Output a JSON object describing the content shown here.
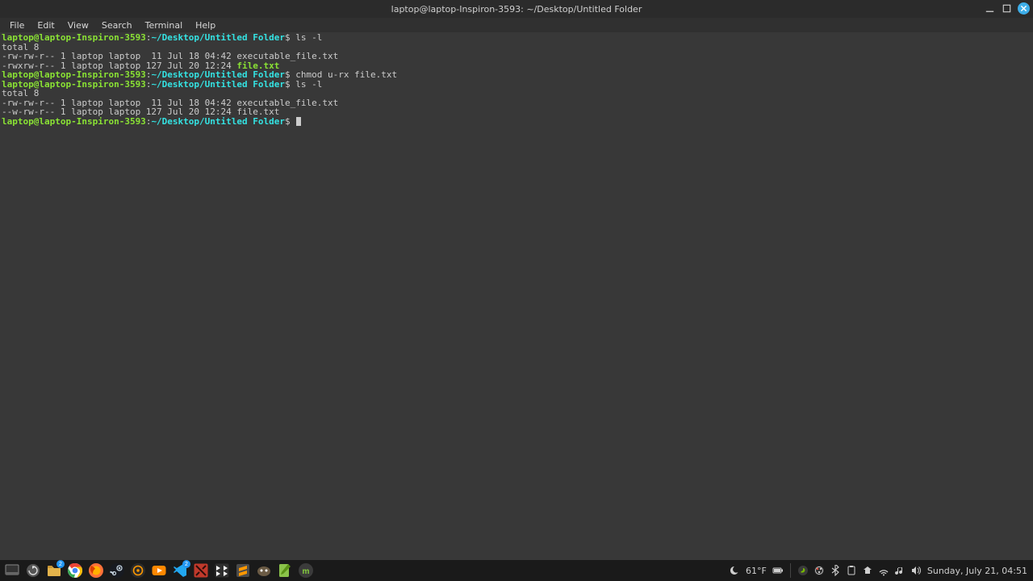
{
  "window": {
    "title": "laptop@laptop-Inspiron-3593: ~/Desktop/Untitled Folder"
  },
  "menu": {
    "items": [
      "File",
      "Edit",
      "View",
      "Search",
      "Terminal",
      "Help"
    ]
  },
  "prompt": {
    "user_host": "laptop@laptop-Inspiron-3593",
    "sep": ":",
    "path": "~/Desktop/Untitled Folder",
    "sigil": "$"
  },
  "session": [
    {
      "type": "prompt",
      "cmd": "ls -l"
    },
    {
      "type": "out",
      "text": "total 8"
    },
    {
      "type": "out",
      "text": "-rw-rw-r-- 1 laptop laptop  11 Jul 18 04:42 executable_file.txt"
    },
    {
      "type": "out-exec",
      "prefix": "-rwxrw-r-- 1 laptop laptop 127 Jul 20 12:24 ",
      "file": "file.txt"
    },
    {
      "type": "prompt",
      "cmd": "chmod u-rx file.txt"
    },
    {
      "type": "prompt",
      "cmd": "ls -l"
    },
    {
      "type": "out",
      "text": "total 8"
    },
    {
      "type": "out",
      "text": "-rw-rw-r-- 1 laptop laptop  11 Jul 18 04:42 executable_file.txt"
    },
    {
      "type": "out",
      "text": "--w-rw-r-- 1 laptop laptop 127 Jul 20 12:24 file.txt"
    },
    {
      "type": "prompt-empty"
    }
  ],
  "tray": {
    "weather": "61°F",
    "datetime": "Sunday, July 21, 04:51"
  },
  "badges": {
    "files": "2",
    "vscode": "2"
  }
}
